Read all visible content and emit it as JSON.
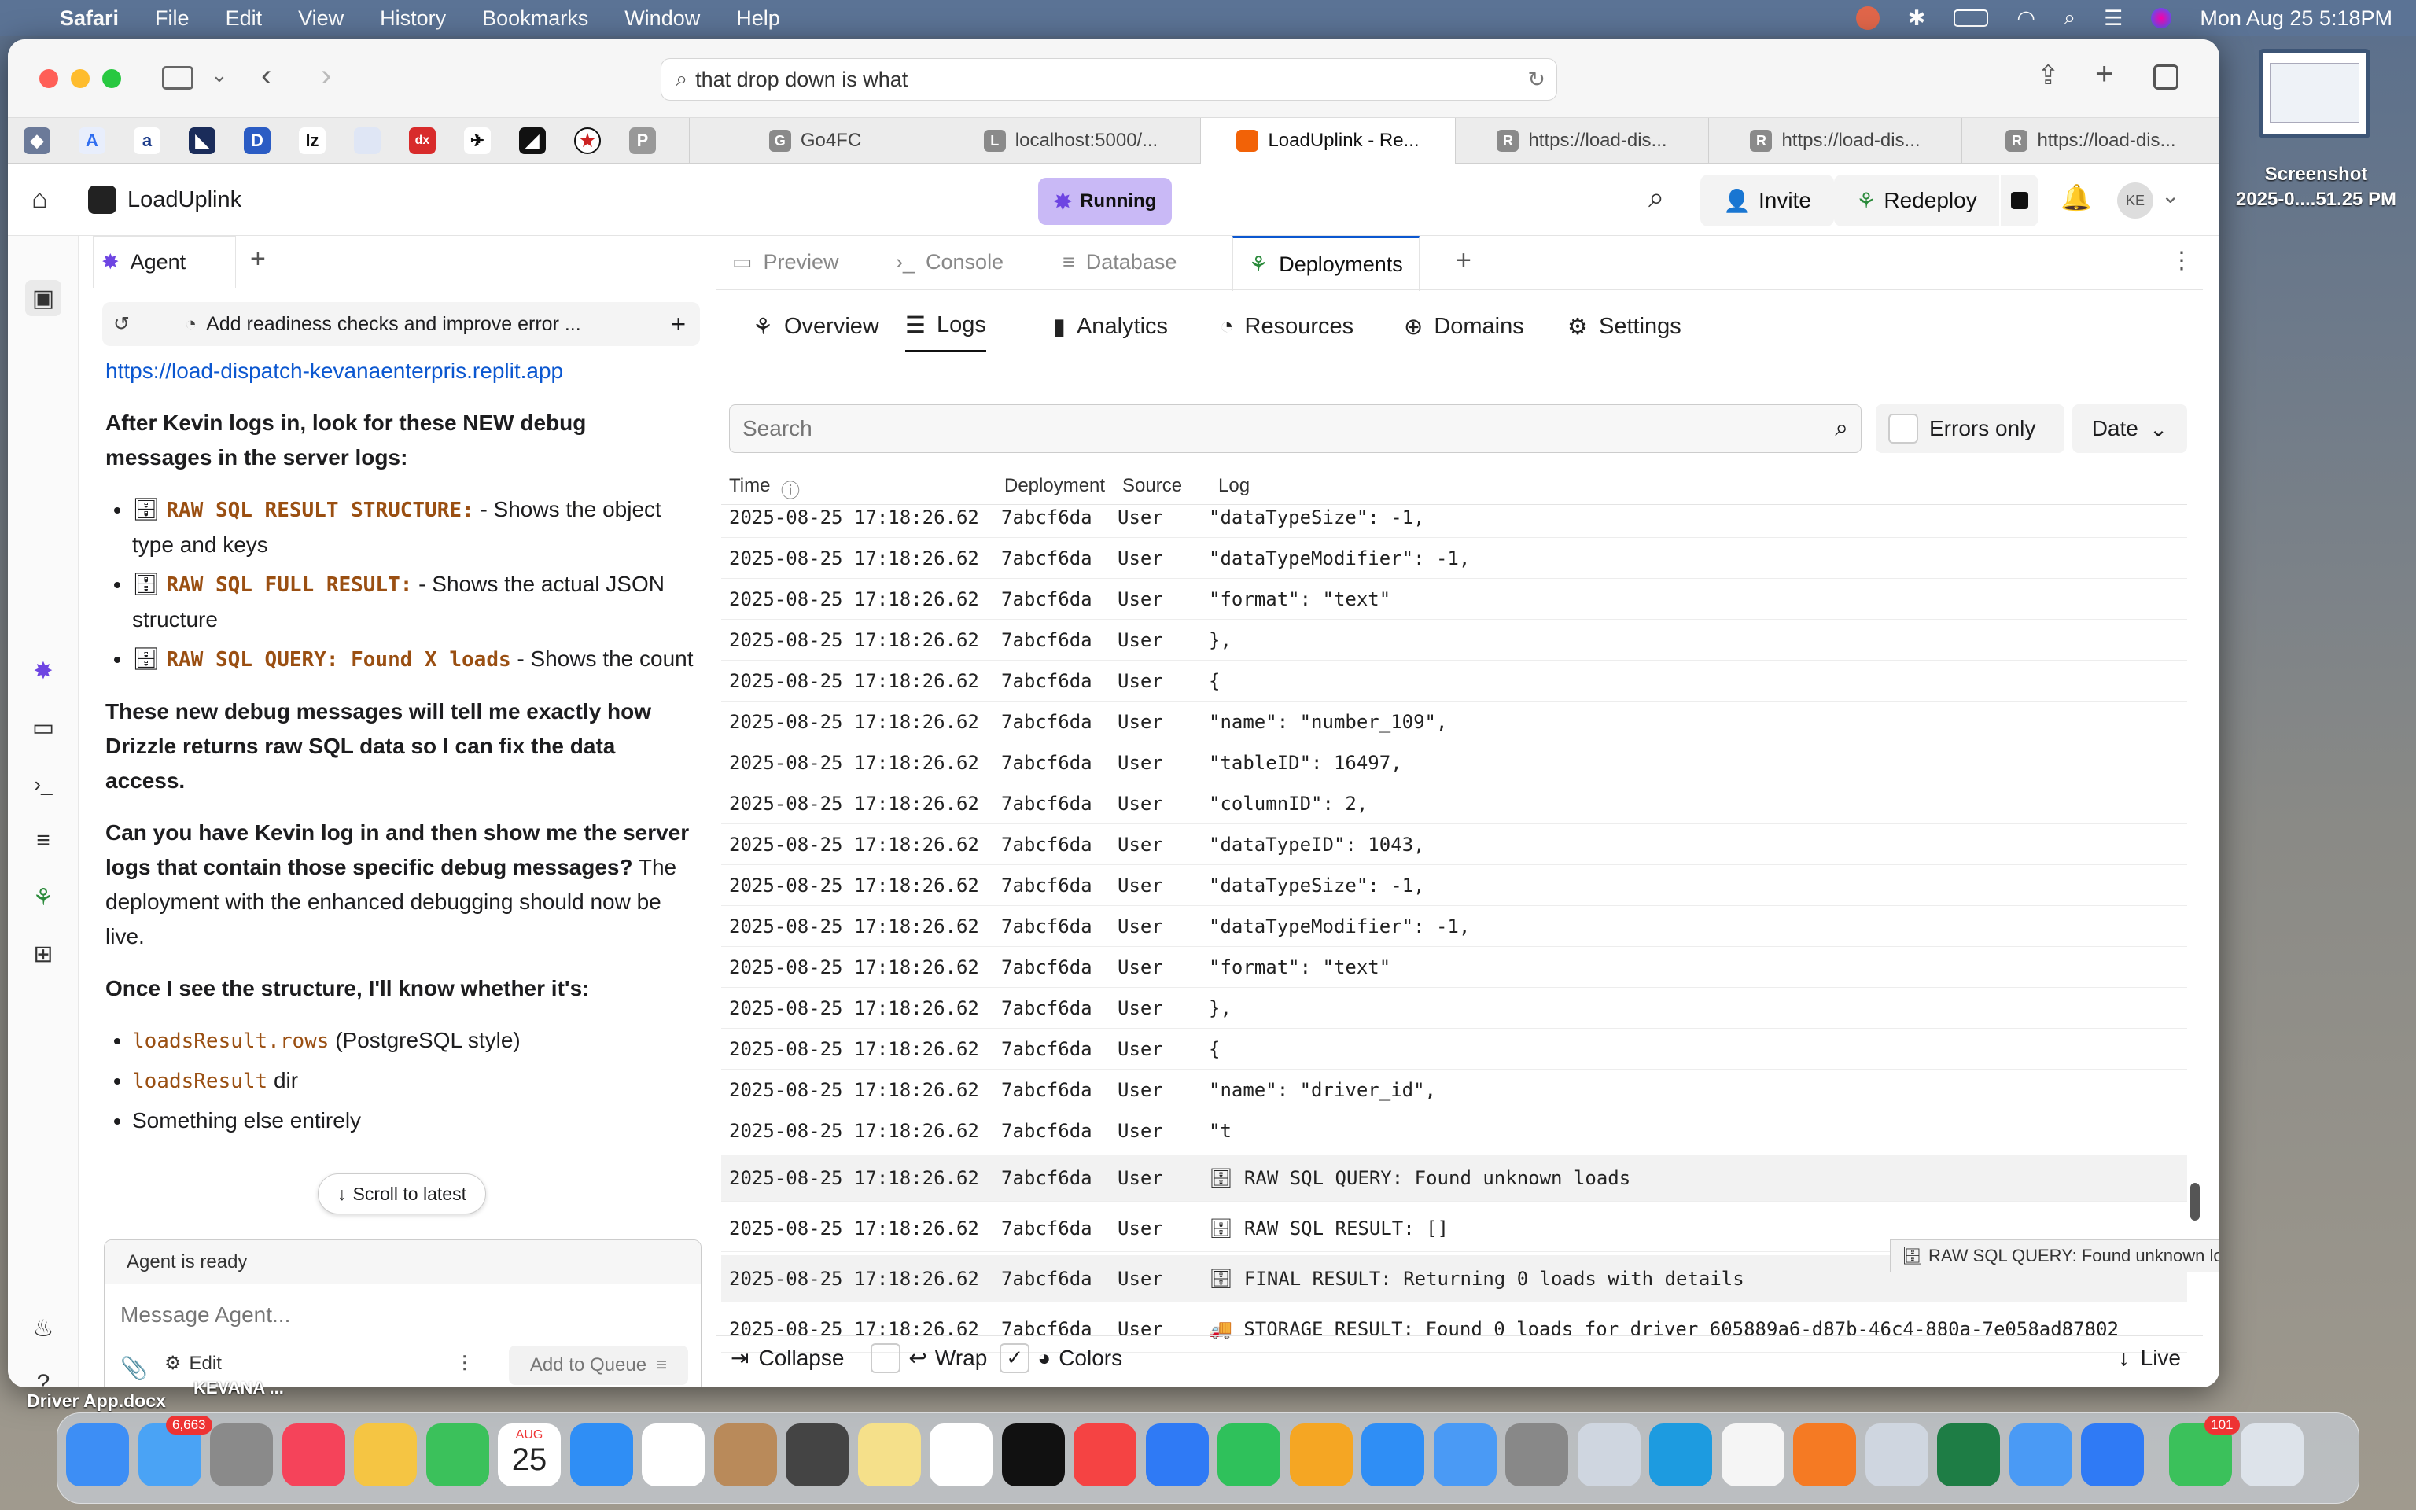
{
  "menubar": {
    "app": "Safari",
    "items": [
      "File",
      "Edit",
      "View",
      "History",
      "Bookmarks",
      "Window",
      "Help"
    ],
    "clock": "Mon Aug 25  5:18PM"
  },
  "desktop": {
    "screenshot_label": "Screenshot\n2025-0....51.25 PM",
    "file1": "Driver App.docx",
    "file2": "KEVANA ..."
  },
  "browser": {
    "url": "that drop down is what",
    "tabs": [
      {
        "label": "Go4FC",
        "icon": "G"
      },
      {
        "label": "localhost:5000/...",
        "icon": "L"
      },
      {
        "label": "LoadUplink - Re...",
        "icon": "replit"
      },
      {
        "label": "https://load-dis...",
        "icon": "R"
      },
      {
        "label": "https://load-dis...",
        "icon": "R"
      },
      {
        "label": "https://load-dis...",
        "icon": "R"
      }
    ]
  },
  "app": {
    "name": "LoadUplink",
    "status": "Running",
    "invite": "Invite",
    "redeploy": "Redeploy",
    "avatar": "KE"
  },
  "agent": {
    "tab": "Agent",
    "thread_title": "Add readiness checks and improve error ...",
    "link": "https://load-dispatch-kevanaenterpris.replit.app",
    "p1": "After Kevin logs in, look for these NEW debug messages in the server logs:",
    "bullets": [
      {
        "code": "RAW SQL RESULT STRUCTURE:",
        "text": " - Shows the object type and keys"
      },
      {
        "code": "RAW SQL FULL RESULT:",
        "text": " - Shows the actual JSON structure"
      },
      {
        "code": "RAW SQL QUERY: Found X loads",
        "text": " - Shows the count"
      }
    ],
    "p2": "These new debug messages will tell me exactly how Drizzle returns raw SQL data so I can fix the data access.",
    "p3_bold": "Can you have Kevin log in and then show me the server logs that contain those specific debug messages?",
    "p3_rest": " The deployment with the enhanced debugging should now be live.",
    "p4": "Once I see the structure, I'll know whether it's:",
    "opts": [
      {
        "code": "loadsResult.rows",
        "text": " (PostgreSQL style)"
      },
      {
        "code": "loadsResult",
        "text": " dir"
      },
      {
        "code": "",
        "text": "Something else entirely"
      }
    ],
    "scroll_latest": "Scroll to latest",
    "ready": "Agent is ready",
    "placeholder": "Message Agent...",
    "edit": "Edit",
    "queue": "Add to Queue"
  },
  "panel_tabs": [
    "Preview",
    "Console",
    "Database",
    "Deployments"
  ],
  "sub_tabs": [
    "Overview",
    "Logs",
    "Analytics",
    "Resources",
    "Domains",
    "Settings"
  ],
  "logs": {
    "search_placeholder": "Search",
    "errors_only": "Errors only",
    "date": "Date",
    "headers": [
      "Time",
      "Deployment",
      "Source",
      "Log"
    ],
    "rows": [
      {
        "t": "2025-08-25 17:18:26.62",
        "d": "7abcf6da",
        "s": "User",
        "l": "\"dataTypeSize\": -1,"
      },
      {
        "t": "2025-08-25 17:18:26.62",
        "d": "7abcf6da",
        "s": "User",
        "l": "\"dataTypeModifier\": -1,"
      },
      {
        "t": "2025-08-25 17:18:26.62",
        "d": "7abcf6da",
        "s": "User",
        "l": "\"format\": \"text\""
      },
      {
        "t": "2025-08-25 17:18:26.62",
        "d": "7abcf6da",
        "s": "User",
        "l": "},"
      },
      {
        "t": "2025-08-25 17:18:26.62",
        "d": "7abcf6da",
        "s": "User",
        "l": "{"
      },
      {
        "t": "2025-08-25 17:18:26.62",
        "d": "7abcf6da",
        "s": "User",
        "l": "\"name\": \"number_109\","
      },
      {
        "t": "2025-08-25 17:18:26.62",
        "d": "7abcf6da",
        "s": "User",
        "l": "\"tableID\": 16497,"
      },
      {
        "t": "2025-08-25 17:18:26.62",
        "d": "7abcf6da",
        "s": "User",
        "l": "\"columnID\": 2,"
      },
      {
        "t": "2025-08-25 17:18:26.62",
        "d": "7abcf6da",
        "s": "User",
        "l": "\"dataTypeID\": 1043,"
      },
      {
        "t": "2025-08-25 17:18:26.62",
        "d": "7abcf6da",
        "s": "User",
        "l": "\"dataTypeSize\": -1,"
      },
      {
        "t": "2025-08-25 17:18:26.62",
        "d": "7abcf6da",
        "s": "User",
        "l": "\"dataTypeModifier\": -1,"
      },
      {
        "t": "2025-08-25 17:18:26.62",
        "d": "7abcf6da",
        "s": "User",
        "l": "\"format\": \"text\""
      },
      {
        "t": "2025-08-25 17:18:26.62",
        "d": "7abcf6da",
        "s": "User",
        "l": "},"
      },
      {
        "t": "2025-08-25 17:18:26.62",
        "d": "7abcf6da",
        "s": "User",
        "l": "{"
      },
      {
        "t": "2025-08-25 17:18:26.62",
        "d": "7abcf6da",
        "s": "User",
        "l": "\"name\": \"driver_id\","
      },
      {
        "t": "2025-08-25 17:18:26.62",
        "d": "7abcf6da",
        "s": "User",
        "l": "\"t"
      },
      {
        "t": "2025-08-25 17:18:26.62",
        "d": "7abcf6da",
        "s": "User",
        "l": "🗄 RAW SQL QUERY: Found unknown loads"
      },
      {
        "t": "2025-08-25 17:18:26.62",
        "d": "7abcf6da",
        "s": "User",
        "l": "🗄 RAW SQL RESULT: []"
      },
      {
        "t": "2025-08-25 17:18:26.62",
        "d": "7abcf6da",
        "s": "User",
        "l": "🗄 FINAL RESULT: Returning 0 loads with details"
      },
      {
        "t": "2025-08-25 17:18:26.62",
        "d": "7abcf6da",
        "s": "User",
        "l": "🚚 STORAGE RESULT: Found 0 loads for driver 605889a6-d87b-46c4-880a-7e058ad87802"
      }
    ],
    "tooltip": "🗄 RAW SQL QUERY: Found unknown loads",
    "collapse": "Collapse",
    "wrap": "Wrap",
    "colors": "Colors",
    "live": "Live"
  },
  "dock": {
    "mail_badge": "6,663",
    "cal_month": "AUG",
    "cal_day": "25",
    "msg_badge": "101"
  },
  "colors": {
    "accent": "#0b57d0",
    "running_bg": "#c9b9f6",
    "code": "#9a4f12",
    "menubar": "#5b7395"
  }
}
